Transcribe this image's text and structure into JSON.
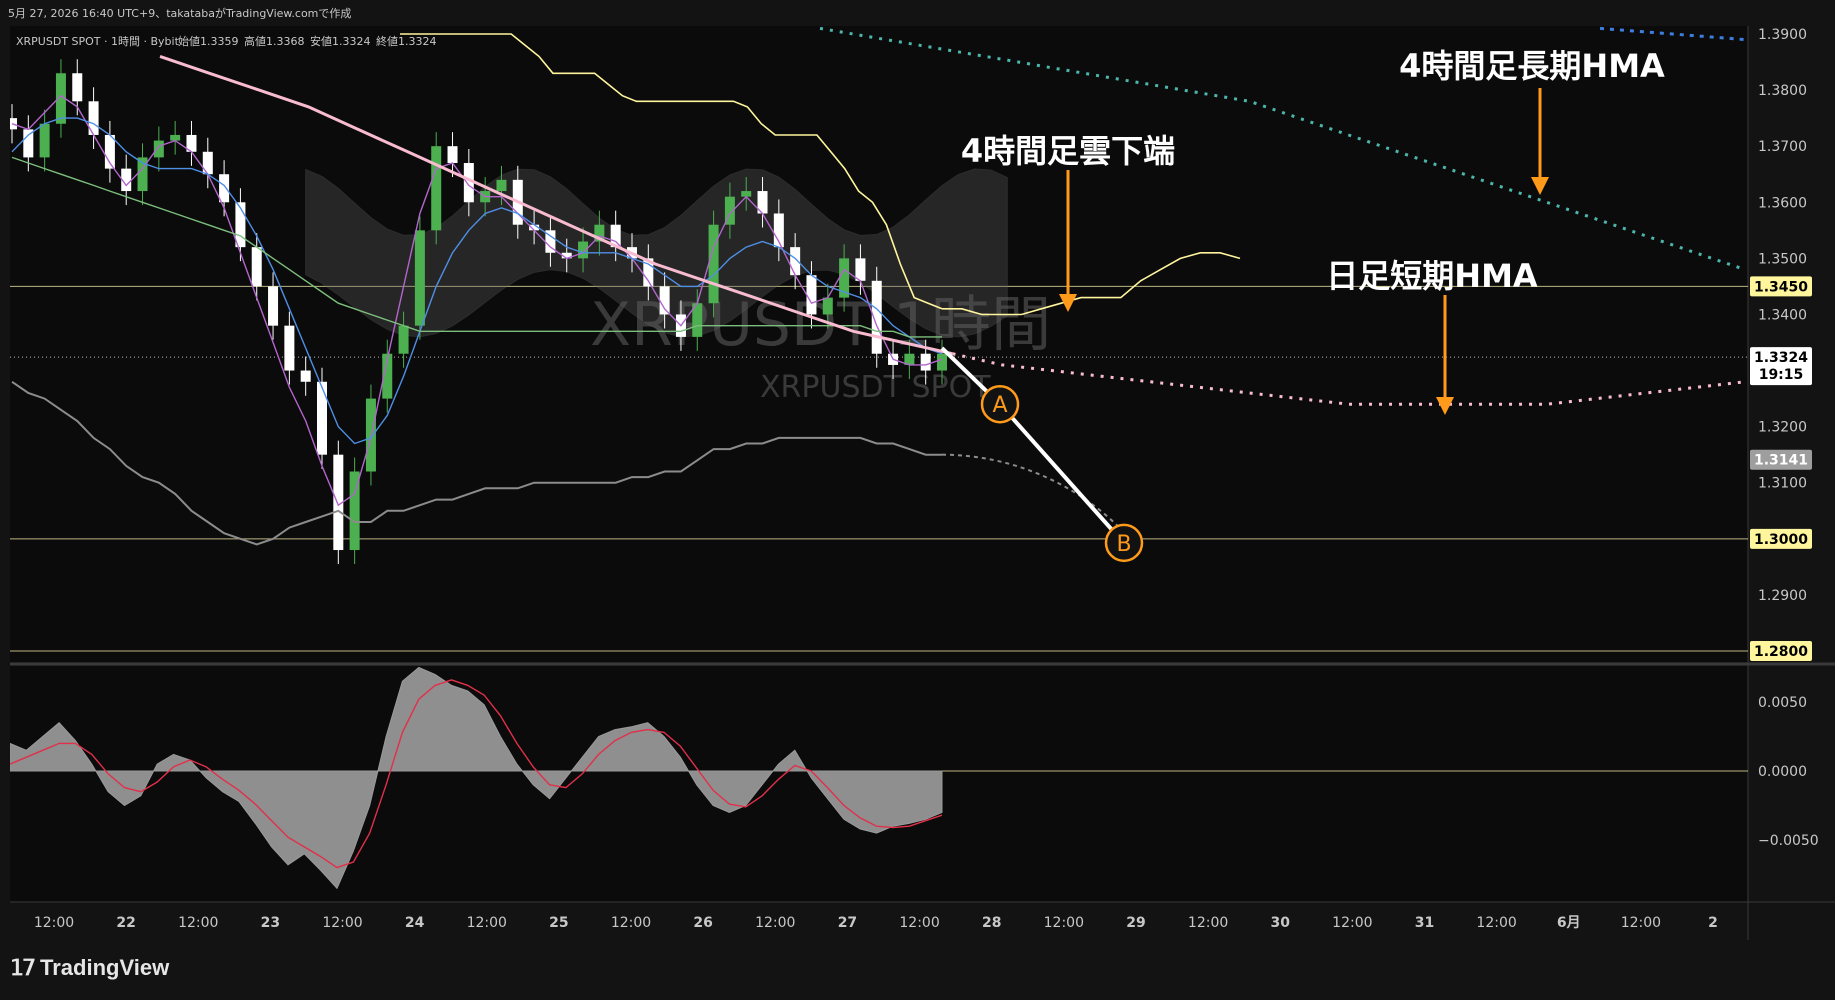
{
  "header": {
    "source_line": "5月 27, 2026 16:40 UTC+9、takatabaがTradingView.comで作成",
    "symbol_line": "XRPUSDT SPOT · 1時間 · Bybit",
    "ohlc": [
      {
        "label": "始値",
        "value": "1.3359"
      },
      {
        "label": "高値",
        "value": "1.3368"
      },
      {
        "label": "安値",
        "value": "1.3324"
      },
      {
        "label": "終値",
        "value": "1.3324"
      }
    ]
  },
  "watermark": {
    "main": "XRPUSDT 1時間",
    "sub": "XRPUSDT SPOT"
  },
  "annotations": {
    "hma_4h_long": "4時間足長期HMA",
    "cloud_4h_lower": "4時間足雲下端",
    "hma_daily_short": "日足短期HMA",
    "point_a": "A",
    "point_b": "B"
  },
  "price_axis": {
    "ticks": [
      "1.3900",
      "1.3800",
      "1.3700",
      "1.3600",
      "1.3500",
      "1.3400",
      "1.3200",
      "1.3100",
      "1.2900"
    ],
    "badges": [
      {
        "value": "1.3450",
        "bg": "#fff59d",
        "fg": "#000000"
      },
      {
        "value": "1.3324",
        "bg": "#ffffff",
        "fg": "#000000",
        "sub": "19:15"
      },
      {
        "value": "1.3141",
        "bg": "#9e9e9e",
        "fg": "#ffffff"
      },
      {
        "value": "1.3000",
        "bg": "#fff59d",
        "fg": "#000000"
      },
      {
        "value": "1.2800",
        "bg": "#fff59d",
        "fg": "#000000"
      }
    ]
  },
  "osc_axis": {
    "ticks": [
      "0.0050",
      "0.0000",
      "−0.0050"
    ]
  },
  "time_axis": {
    "ticks": [
      "12:00",
      "22",
      "12:00",
      "23",
      "12:00",
      "24",
      "12:00",
      "25",
      "12:00",
      "26",
      "12:00",
      "27",
      "12:00",
      "28",
      "12:00",
      "29",
      "12:00",
      "30",
      "12:00",
      "31",
      "12:00",
      "6月",
      "12:00",
      "2"
    ]
  },
  "branding": {
    "name": "TradingView"
  },
  "chart_data": {
    "type": "line",
    "symbol": "XRPUSDT SPOT",
    "timeframe": "1時間",
    "ylim": [
      1.27,
      1.392
    ],
    "horizontal_levels": [
      1.345,
      1.3,
      1.28
    ],
    "last_price": 1.3324,
    "series": [
      {
        "role": "close",
        "color": "#ffffff",
        "values": [
          1.373,
          1.368,
          1.374,
          1.383,
          1.378,
          1.372,
          1.366,
          1.362,
          1.368,
          1.371,
          1.372,
          1.369,
          1.365,
          1.36,
          1.352,
          1.345,
          1.338,
          1.33,
          1.328,
          1.315,
          1.298,
          1.312,
          1.325,
          1.333,
          1.338,
          1.355,
          1.37,
          1.367,
          1.36,
          1.362,
          1.364,
          1.356,
          1.355,
          1.351,
          1.35,
          1.353,
          1.356,
          1.352,
          1.35,
          1.345,
          1.34,
          1.336,
          1.342,
          1.356,
          1.361,
          1.362,
          1.358,
          1.352,
          1.347,
          1.34,
          1.343,
          1.35,
          1.346,
          1.333,
          1.331,
          1.333,
          1.33,
          1.333
        ]
      },
      {
        "role": "fast_hma",
        "color": "#b366cc",
        "values": [
          1.374,
          1.373,
          1.376,
          1.379,
          1.377,
          1.372,
          1.367,
          1.363,
          1.366,
          1.37,
          1.371,
          1.369,
          1.365,
          1.359,
          1.351,
          1.343,
          1.335,
          1.327,
          1.321,
          1.313,
          1.306,
          1.308,
          1.318,
          1.332,
          1.345,
          1.358,
          1.366,
          1.367,
          1.363,
          1.361,
          1.361,
          1.358,
          1.355,
          1.352,
          1.35,
          1.351,
          1.354,
          1.353,
          1.35,
          1.346,
          1.341,
          1.338,
          1.342,
          1.352,
          1.358,
          1.361,
          1.358,
          1.353,
          1.347,
          1.342,
          1.343,
          1.348,
          1.346,
          1.338,
          1.332,
          1.331,
          1.331,
          1.332
        ]
      },
      {
        "role": "slow_hma",
        "color": "#4f8fe6",
        "values": [
          1.369,
          1.372,
          1.374,
          1.375,
          1.375,
          1.374,
          1.372,
          1.369,
          1.367,
          1.366,
          1.366,
          1.366,
          1.365,
          1.363,
          1.359,
          1.354,
          1.348,
          1.341,
          1.334,
          1.327,
          1.32,
          1.317,
          1.318,
          1.322,
          1.329,
          1.337,
          1.345,
          1.351,
          1.355,
          1.358,
          1.359,
          1.358,
          1.356,
          1.354,
          1.352,
          1.351,
          1.351,
          1.351,
          1.35,
          1.349,
          1.347,
          1.345,
          1.345,
          1.347,
          1.35,
          1.352,
          1.353,
          1.352,
          1.35,
          1.347,
          1.345,
          1.344,
          1.343,
          1.341,
          1.338,
          1.336,
          1.334,
          1.333
        ]
      },
      {
        "role": "ema",
        "color": "#7cbf7c",
        "values": [
          1.368,
          1.367,
          1.366,
          1.365,
          1.364,
          1.363,
          1.362,
          1.361,
          1.36,
          1.359,
          1.358,
          1.357,
          1.356,
          1.355,
          1.354,
          1.352,
          1.35,
          1.348,
          1.346,
          1.344,
          1.342,
          1.341,
          1.34,
          1.339,
          1.338,
          1.337,
          1.337,
          1.337,
          1.337,
          1.337,
          1.337,
          1.337,
          1.337,
          1.337,
          1.337,
          1.337,
          1.337,
          1.337,
          1.337,
          1.337,
          1.337,
          1.337,
          1.338,
          1.338,
          1.338,
          1.338,
          1.338,
          1.338,
          1.338,
          1.338,
          1.338,
          1.338,
          1.338,
          1.337,
          1.337,
          1.336,
          1.336,
          1.336
        ]
      },
      {
        "role": "lower_band",
        "color": "#8c8c8c",
        "values": [
          1.328,
          1.326,
          1.325,
          1.323,
          1.321,
          1.318,
          1.316,
          1.313,
          1.311,
          1.31,
          1.308,
          1.305,
          1.303,
          1.301,
          1.3,
          1.299,
          1.3,
          1.302,
          1.303,
          1.304,
          1.305,
          1.303,
          1.303,
          1.305,
          1.305,
          1.306,
          1.307,
          1.307,
          1.308,
          1.309,
          1.309,
          1.309,
          1.31,
          1.31,
          1.31,
          1.31,
          1.31,
          1.31,
          1.311,
          1.311,
          1.312,
          1.312,
          1.314,
          1.316,
          1.316,
          1.317,
          1.317,
          1.318,
          1.318,
          1.318,
          1.318,
          1.318,
          1.318,
          1.317,
          1.317,
          1.316,
          1.315,
          1.315
        ]
      },
      {
        "role": "htf_line",
        "color": "#fff59d",
        "values": [
          1.39,
          1.39,
          1.39,
          1.39,
          1.39,
          1.39,
          1.39,
          1.39,
          1.39,
          1.39,
          1.39,
          1.39,
          1.39,
          1.39,
          1.39,
          1.39,
          1.39,
          1.39,
          1.39,
          1.39,
          1.39,
          1.39,
          1.39,
          1.39,
          1.39,
          1.39,
          1.39,
          1.388,
          1.386,
          1.383,
          1.383,
          1.383,
          1.383,
          1.381,
          1.379,
          1.378,
          1.378,
          1.378,
          1.378,
          1.378,
          1.378,
          1.378,
          1.378,
          1.377,
          1.374,
          1.372,
          1.372,
          1.372,
          1.372,
          1.369,
          1.366,
          1.362,
          1.36,
          1.356,
          1.349,
          1.343,
          1.342,
          1.341
        ]
      },
      {
        "role": "htf_line_projection",
        "color": "#fff59d",
        "values": [
          1.341,
          1.341,
          1.34,
          1.34,
          1.34,
          1.341,
          1.342,
          1.343,
          1.343,
          1.343,
          1.346,
          1.348,
          1.35,
          1.351,
          1.351,
          1.35
        ]
      },
      {
        "role": "hma_4h_long",
        "color": "#4db6ac",
        "values": [
          1.391,
          1.39,
          1.389,
          1.388,
          1.387,
          1.386,
          1.385,
          1.384,
          1.383,
          1.382,
          1.381,
          1.38,
          1.379,
          1.378,
          1.376,
          1.374,
          1.372,
          1.37,
          1.368,
          1.366,
          1.364,
          1.362,
          1.36,
          1.358,
          1.356,
          1.354,
          1.352,
          1.35,
          1.348
        ]
      },
      {
        "role": "hma_daily_short",
        "color": "#f8bbd0",
        "values": [
          1.386,
          1.383,
          1.38,
          1.377,
          1.373,
          1.369,
          1.365,
          1.361,
          1.357,
          1.353,
          1.349,
          1.346,
          1.343,
          1.34,
          1.337,
          1.335,
          1.333,
          1.331,
          1.33,
          1.329,
          1.328,
          1.327,
          1.326,
          1.325,
          1.324,
          1.324,
          1.324,
          1.324,
          1.324,
          1.325,
          1.326,
          1.327,
          1.328
        ]
      },
      {
        "role": "scenario_path",
        "color": "#ffffff",
        "points": [
          {
            "label": "start",
            "y": 1.334
          },
          {
            "label": "A",
            "y": 1.324
          },
          {
            "label": "B",
            "y": 1.3
          }
        ]
      }
    ],
    "oscillator": {
      "ylim": [
        -0.0085,
        0.0095
      ],
      "histogram": [
        0.002,
        0.0015,
        0.0025,
        0.0035,
        0.0022,
        0.0005,
        -0.0015,
        -0.0025,
        -0.0018,
        0.0005,
        0.0012,
        0.0008,
        -0.0005,
        -0.0015,
        -0.0022,
        -0.0038,
        -0.0055,
        -0.0068,
        -0.006,
        -0.0072,
        -0.0085,
        -0.0058,
        -0.0025,
        0.0025,
        0.0065,
        0.0075,
        0.007,
        0.0062,
        0.0058,
        0.0048,
        0.0025,
        0.0005,
        -0.001,
        -0.002,
        -0.0005,
        0.001,
        0.0025,
        0.003,
        0.0032,
        0.0035,
        0.0025,
        0.001,
        -0.001,
        -0.0025,
        -0.003,
        -0.0025,
        -0.001,
        0.0005,
        0.0015,
        -0.0005,
        -0.002,
        -0.0035,
        -0.0042,
        -0.0045,
        -0.004,
        -0.0038,
        -0.0035,
        -0.003
      ],
      "signal": [
        0.0005,
        0.001,
        0.0015,
        0.002,
        0.002,
        0.0012,
        -0.0002,
        -0.0012,
        -0.0015,
        -0.0008,
        0.0003,
        0.0008,
        0.0003,
        -0.0006,
        -0.0014,
        -0.0024,
        -0.0036,
        -0.0048,
        -0.0055,
        -0.0062,
        -0.007,
        -0.0066,
        -0.0045,
        -0.001,
        0.0028,
        0.0052,
        0.0062,
        0.0066,
        0.0062,
        0.0055,
        0.004,
        0.002,
        0.0003,
        -0.001,
        -0.0012,
        -0.0002,
        0.0012,
        0.0022,
        0.0028,
        0.003,
        0.0028,
        0.0018,
        0.0002,
        -0.0014,
        -0.0024,
        -0.0026,
        -0.0018,
        -0.0006,
        0.0004,
        0.0,
        -0.0012,
        -0.0025,
        -0.0034,
        -0.004,
        -0.0041,
        -0.004,
        -0.0036,
        -0.0032
      ]
    }
  }
}
